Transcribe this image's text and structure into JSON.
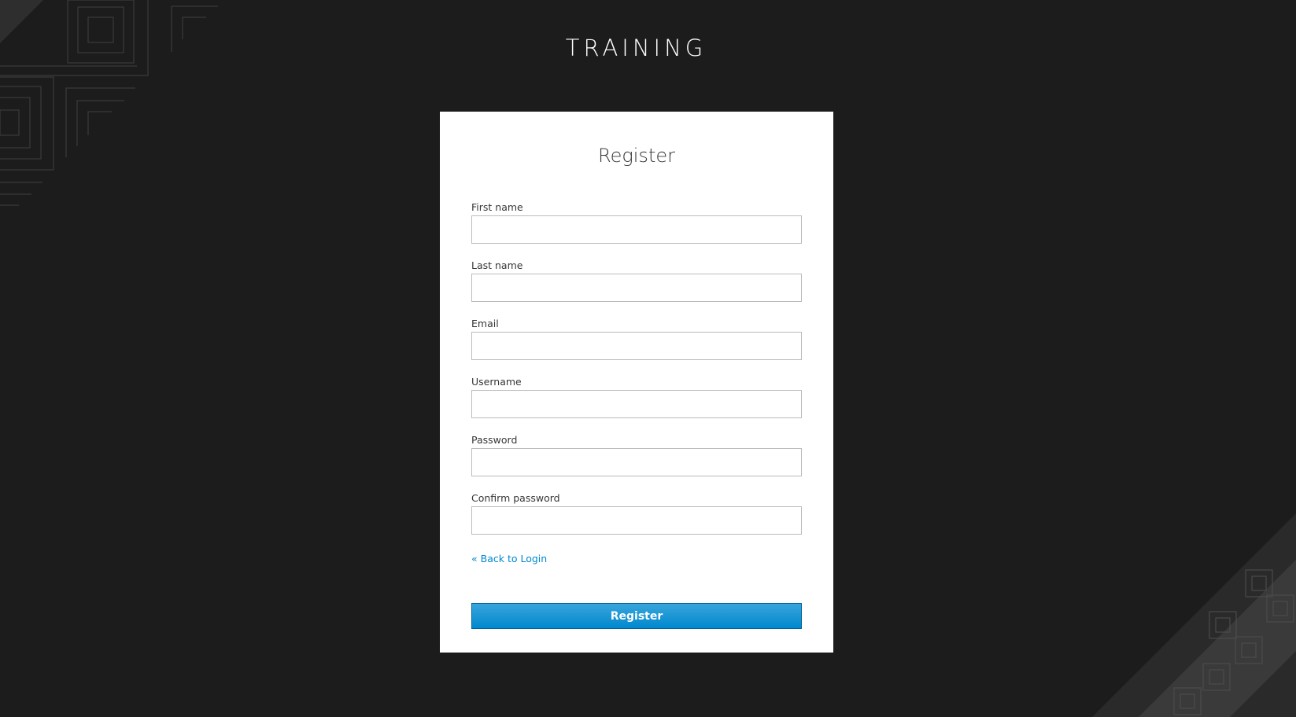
{
  "header": {
    "title": "TRAINING"
  },
  "form": {
    "title": "Register",
    "fields": [
      {
        "label": "First name",
        "value": ""
      },
      {
        "label": "Last name",
        "value": ""
      },
      {
        "label": "Email",
        "value": ""
      },
      {
        "label": "Username",
        "value": ""
      },
      {
        "label": "Password",
        "value": ""
      },
      {
        "label": "Confirm password",
        "value": ""
      }
    ],
    "back_link": "« Back to Login",
    "submit_label": "Register"
  },
  "colors": {
    "background": "#1c1c1c",
    "card": "#ffffff",
    "accent": "#0088ce",
    "text": "#363636"
  }
}
